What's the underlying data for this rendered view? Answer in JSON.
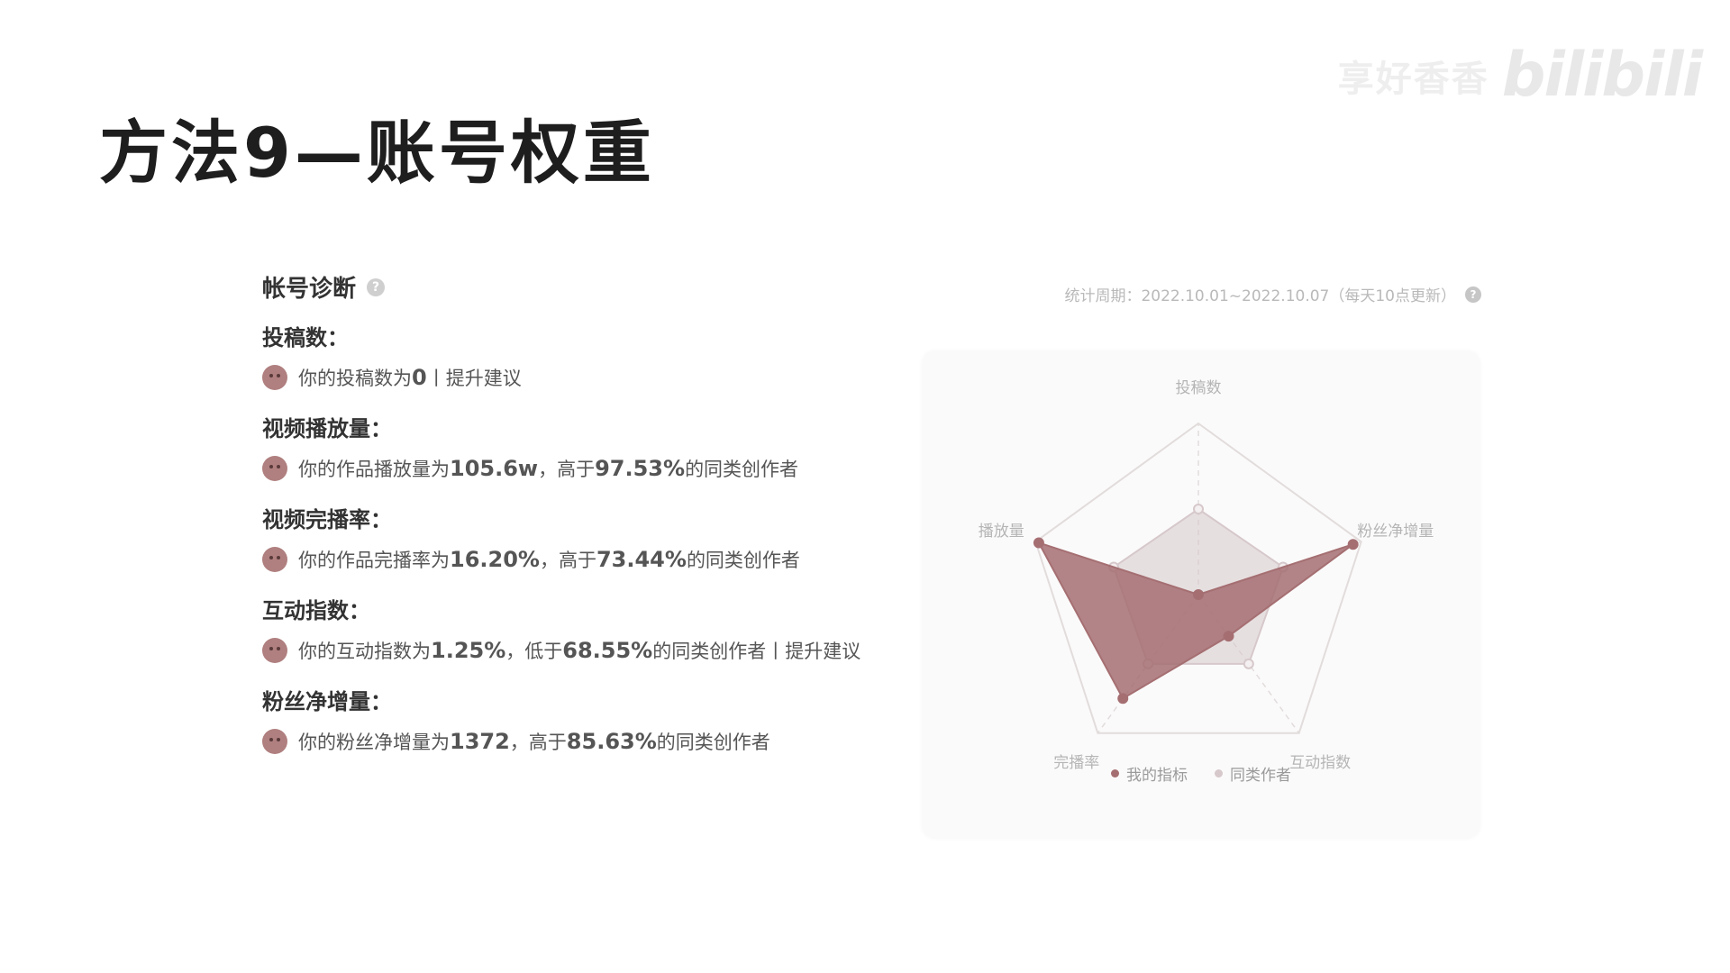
{
  "watermark": {
    "text": "享好香香",
    "logo": "bilibili"
  },
  "slide": {
    "title": "方法9—账号权重"
  },
  "diagnosis": {
    "title": "帐号诊断",
    "help_icon": "help-circle-icon",
    "period": "统计周期：2022.10.01~2022.10.07（每天10点更新）",
    "metrics": [
      {
        "label": "投稿数：",
        "pre": "你的投稿数为",
        "v1": "0",
        "mid": "",
        "v2": "",
        "post": "丨提升建议"
      },
      {
        "label": "视频播放量：",
        "pre": "你的作品播放量为",
        "v1": "105.6w",
        "mid": "，高于",
        "v2": "97.53%",
        "post": "的同类创作者"
      },
      {
        "label": "视频完播率：",
        "pre": "你的作品完播率为",
        "v1": "16.20%",
        "mid": "，高于",
        "v2": "73.44%",
        "post": "的同类创作者"
      },
      {
        "label": "互动指数：",
        "pre": "你的互动指数为",
        "v1": "1.25%",
        "mid": "，低于",
        "v2": "68.55%",
        "post": "的同类创作者丨提升建议"
      },
      {
        "label": "粉丝净增量：",
        "pre": "你的粉丝净增量为",
        "v1": "1372",
        "mid": "，高于",
        "v2": "85.63%",
        "post": "的同类创作者"
      }
    ]
  },
  "chart_data": {
    "type": "radar",
    "axes": [
      "投稿数",
      "粉丝净增量",
      "互动指数",
      "完播率",
      "播放量"
    ],
    "range": [
      0,
      1
    ],
    "series": [
      {
        "name": "我的指标",
        "values": [
          0.0,
          0.95,
          0.3,
          0.75,
          0.98
        ],
        "color": "#a56f72"
      },
      {
        "name": "同类作者",
        "values": [
          0.5,
          0.52,
          0.5,
          0.5,
          0.52
        ],
        "color": "#d6c8cb"
      }
    ],
    "grid": true
  },
  "colors": {
    "accent": "#a56f72",
    "compare": "#d6c8cb",
    "face": "#b07f7f"
  }
}
